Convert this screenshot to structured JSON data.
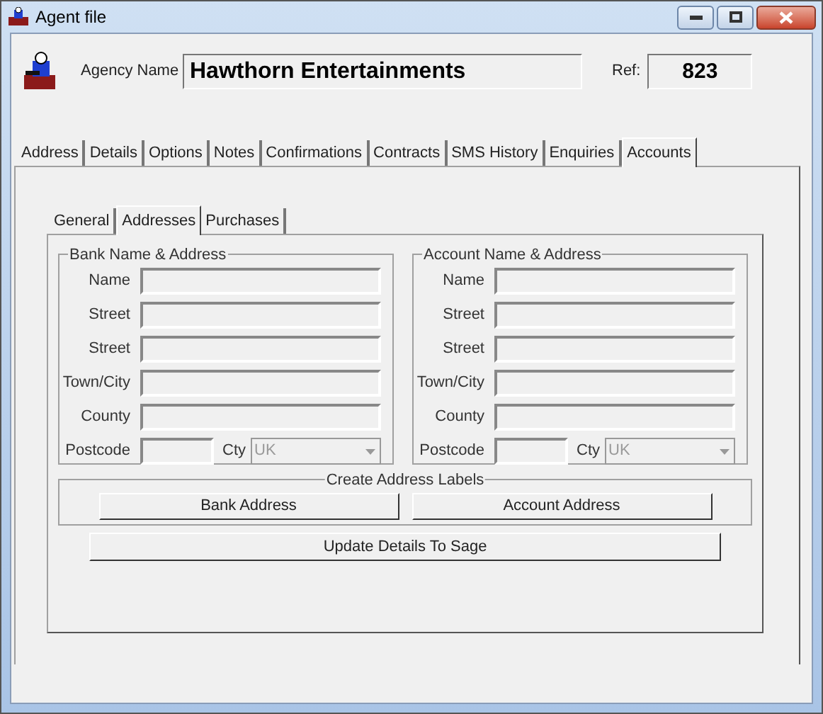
{
  "window": {
    "title": "Agent file"
  },
  "header": {
    "agency_name_label": "Agency Name",
    "agency_name": "Hawthorn Entertainments",
    "ref_label": "Ref:",
    "ref": "823"
  },
  "tabs": [
    {
      "label": "Address",
      "selected": false
    },
    {
      "label": "Details",
      "selected": false
    },
    {
      "label": "Options",
      "selected": false
    },
    {
      "label": "Notes",
      "selected": false
    },
    {
      "label": "Confirmations",
      "selected": false
    },
    {
      "label": "Contracts",
      "selected": false
    },
    {
      "label": "SMS History",
      "selected": false
    },
    {
      "label": "Enquiries",
      "selected": false
    },
    {
      "label": "Accounts",
      "selected": true
    }
  ],
  "subtabs": [
    {
      "label": "General",
      "selected": false
    },
    {
      "label": "Addresses",
      "selected": true
    },
    {
      "label": "Purchases",
      "selected": false
    }
  ],
  "groups": [
    {
      "title": "Bank Name & Address",
      "fields": [
        {
          "label": "Name",
          "disabled": true
        },
        {
          "label": "Street",
          "disabled": true
        },
        {
          "label": "Street",
          "disabled": true
        },
        {
          "label": "Town/City",
          "disabled": true
        },
        {
          "label": "County",
          "disabled": true
        }
      ],
      "postcode": {
        "label": "Postcode",
        "disabled": true
      },
      "country": {
        "label": "Cty",
        "value": "UK",
        "disabled": true
      }
    },
    {
      "title": "Account Name & Address",
      "fields": [
        {
          "label": "Name",
          "disabled": true
        },
        {
          "label": "Street",
          "disabled": true
        },
        {
          "label": "Street",
          "disabled": true
        },
        {
          "label": "Town/City",
          "disabled": true
        },
        {
          "label": "County",
          "disabled": true
        }
      ],
      "postcode": {
        "label": "Postcode",
        "disabled": true
      },
      "country": {
        "label": "Cty",
        "value": "UK",
        "disabled": true
      }
    }
  ],
  "labels_group": {
    "title": "Create Address Labels",
    "buttons": [
      "Bank Address",
      "Account Address"
    ]
  },
  "update_button": "Update Details To Sage"
}
